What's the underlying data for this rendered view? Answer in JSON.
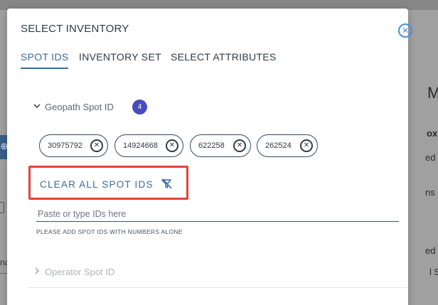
{
  "modal": {
    "title": "SELECT INVENTORY",
    "close_icon": "close-circle-icon"
  },
  "tabs": [
    {
      "label": "SPOT IDS",
      "active": true
    },
    {
      "label": "INVENTORY SET",
      "active": false
    },
    {
      "label": "SELECT ATTRIBUTES",
      "active": false
    }
  ],
  "geopath_section": {
    "label": "Geopath Spot ID",
    "count": "4",
    "expanded": true,
    "chips": [
      "30975792",
      "14924668",
      "622258",
      "262524"
    ]
  },
  "clear_all": {
    "label": "CLEAR ALL SPOT IDS",
    "icon": "clear-filter-icon"
  },
  "ids_input": {
    "value": "",
    "placeholder": "Paste or type IDs here",
    "helper": "PLEASE ADD SPOT IDS WITH NUMBERS ALONE"
  },
  "operator_section": {
    "label": "Operator Spot ID",
    "expanded": false
  },
  "background": {
    "right_fragments": [
      "M",
      "ox",
      "ed",
      "ns",
      "ed",
      "l S"
    ],
    "left_fragment": "na"
  },
  "colors": {
    "accent": "#3a6a9a",
    "badge": "#4a4abf",
    "highlight_box": "#e0433a",
    "close": "#4a8fd4"
  }
}
